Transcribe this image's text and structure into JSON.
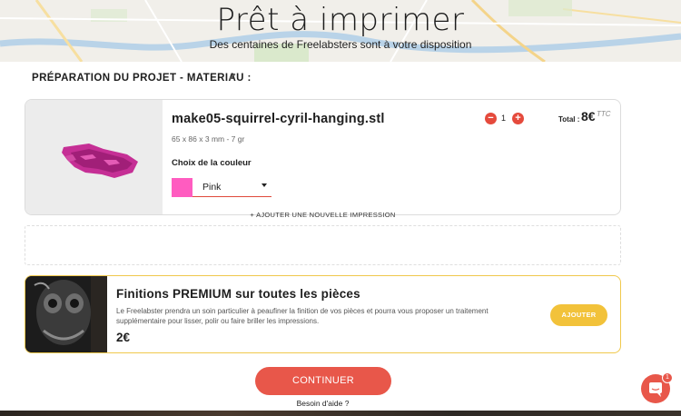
{
  "hero": {
    "title": "Prêt à imprimer",
    "subtitle": "Des centaines de Freelabsters sont à votre disposition"
  },
  "section": {
    "title": "PRÉPARATION DU PROJET - MATERIAU :",
    "edit_icon": "pencil-icon"
  },
  "item": {
    "file_name": "make05-squirrel-cyril-hanging.stl",
    "dimensions": "65 x 86 x 3 mm - 7 gr",
    "color_label": "Choix de la couleur",
    "color_value": "Pink",
    "color_hex": "#ff5cc0",
    "quantity": "1",
    "minus_label": "−",
    "plus_label": "+",
    "total_label": "Total :",
    "total_value": "8€",
    "total_suffix": "TTC"
  },
  "add_print_label": "+ AJOUTER UNE NOUVELLE IMPRESSION",
  "premium": {
    "title": "Finitions PREMIUM sur toutes les pièces",
    "description": "Le Freelabster prendra un soin particulier à peaufiner la finition de vos pièces et pourra vous proposer un traitement supplémentaire pour lisser, polir ou faire briller les impressions.",
    "price": "2€",
    "add_button": "AJOUTER"
  },
  "actions": {
    "continue": "CONTINUER",
    "help": "Besoin d'aide ?"
  },
  "chat": {
    "icon": "chat-icon",
    "badge": "1"
  },
  "colors": {
    "accent": "#e8574a",
    "premium": "#f2c23a"
  }
}
